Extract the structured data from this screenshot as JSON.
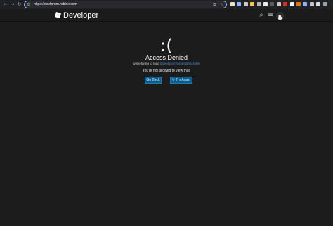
{
  "browser": {
    "url": "https://devforum.roblox.com",
    "nav": {
      "back": "←",
      "forward": "→",
      "reload": "↻"
    },
    "url_icons": {
      "site_info": "⚙",
      "install": "⧉",
      "bookmark": "☆"
    },
    "extensions": [
      {
        "icon": "extension-icon",
        "color": "#e8e0c8"
      },
      {
        "icon": "extension-icon",
        "color": "#8ab4f8"
      },
      {
        "icon": "extension-icon",
        "color": "#c8c8c8"
      },
      {
        "icon": "extension-icon",
        "color": "#f2c94c"
      },
      {
        "icon": "extension-icon",
        "color": "#b5b5b5"
      },
      {
        "icon": "extension-icon",
        "color": "#e6e6e6"
      },
      {
        "icon": "extension-icon",
        "color": "#5c5c5c"
      },
      {
        "icon": "extension-icon",
        "color": "#c9c9c9"
      },
      {
        "icon": "extension-icon",
        "color": "#d93025"
      },
      {
        "icon": "extension-icon",
        "color": "#f1f3f4"
      },
      {
        "icon": "extension-icon",
        "color": "#e37400"
      },
      {
        "icon": "extension-icon",
        "color": "#8ab4f8"
      },
      {
        "icon": "extension-icon",
        "color": "#c5c5c5"
      },
      {
        "icon": "extension-icon",
        "color": "#dadce0"
      },
      {
        "icon": "extension-icon",
        "color": "#9aa0a6"
      }
    ]
  },
  "header": {
    "brand": "Developer",
    "search_glyph": "⌕",
    "menu_glyph": "≡"
  },
  "error": {
    "face": ":(",
    "title": "Access Denied",
    "subtitle_prefix": "while trying to load",
    "subtitle_link": "/latest.json?ascending=false",
    "message": "You're not allowed to view that.",
    "go_back": "Go Back",
    "try_again": "Try Again",
    "try_again_glyph": "↻"
  },
  "colors": {
    "accent": "#0b5e8c",
    "link": "#4a8fd8",
    "background": "#1c1c1c"
  }
}
